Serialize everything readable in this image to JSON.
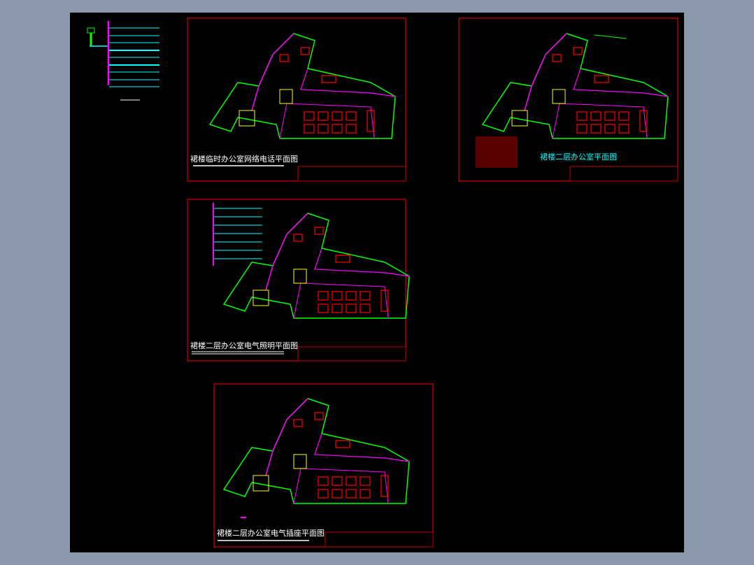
{
  "drawings": [
    {
      "title": "裙楼临时办公室网络电话平面图"
    },
    {
      "title": "裙楼二层办公室平面图"
    },
    {
      "title": "裙楼二层办公室电气照明平面图"
    },
    {
      "title": "裙楼二层办公室电气插座平面图"
    }
  ],
  "colors": {
    "background": "#8c99ad",
    "canvas": "#000000",
    "frame": "#ff0000",
    "wall": "#00ff00",
    "wall2": "#ff00ff",
    "cyan": "#00ffff"
  }
}
